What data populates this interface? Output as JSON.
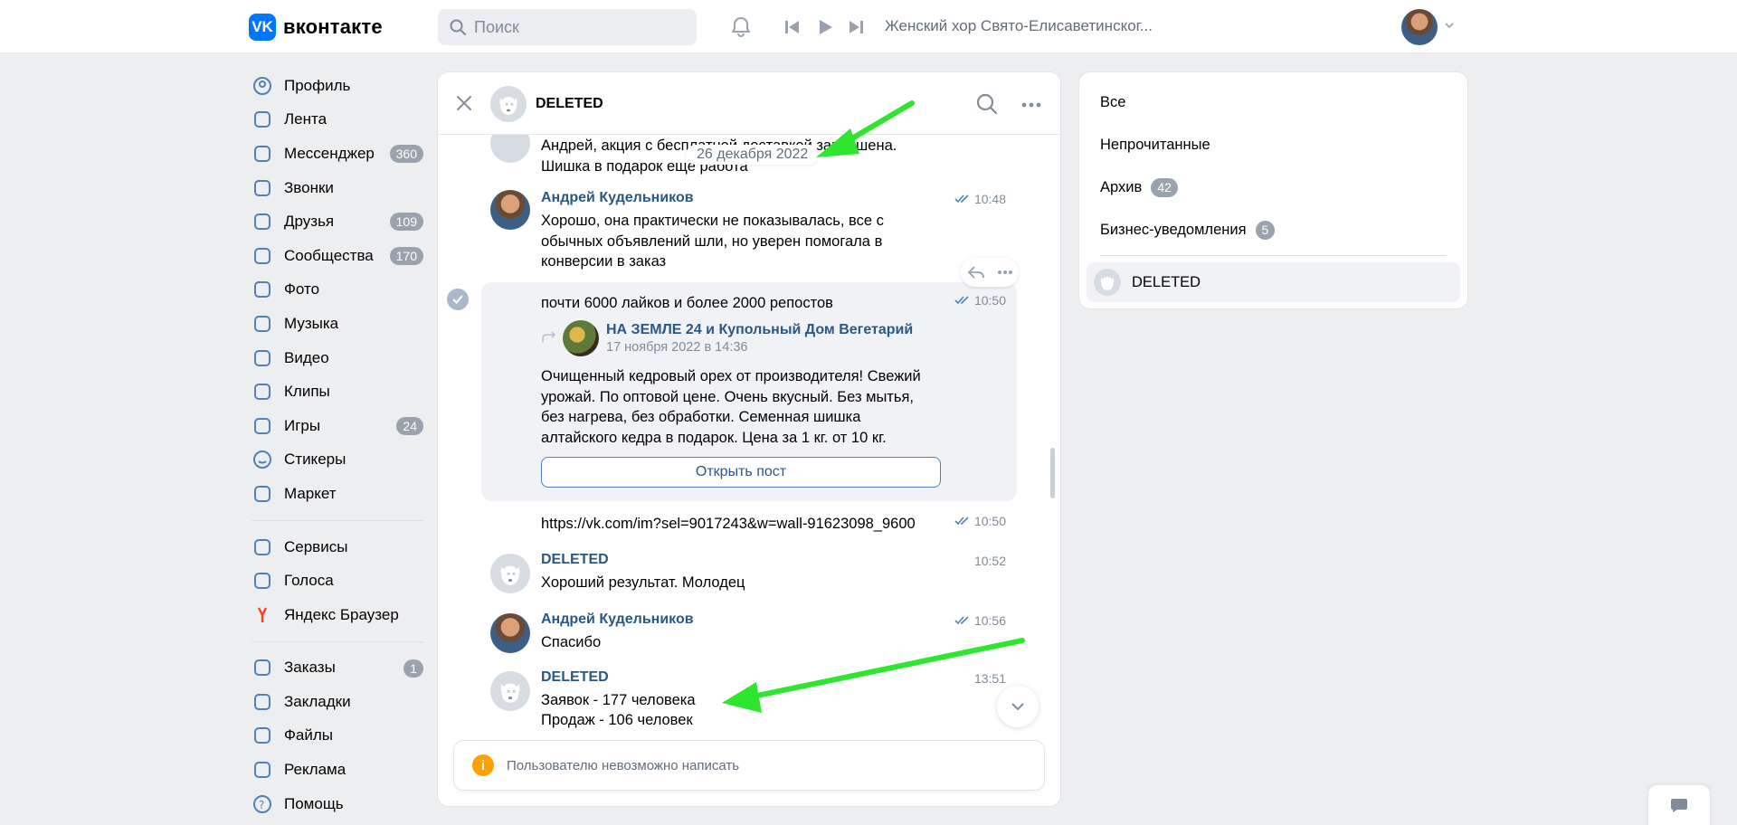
{
  "header": {
    "logo_text": "вконтакте",
    "logo_mark": "VK",
    "search_placeholder": "Поиск",
    "player_title": "Женский хор Свято-Елисаветинског..."
  },
  "nav": {
    "items": [
      {
        "label": "Профиль",
        "icon": "profile-icon"
      },
      {
        "label": "Лента",
        "icon": "feed-icon"
      },
      {
        "label": "Мессенджер",
        "icon": "messenger-icon",
        "badge": "360"
      },
      {
        "label": "Звонки",
        "icon": "phone-icon"
      },
      {
        "label": "Друзья",
        "icon": "friends-icon",
        "badge": "109"
      },
      {
        "label": "Сообщества",
        "icon": "communities-icon",
        "badge": "170"
      },
      {
        "label": "Фото",
        "icon": "photo-icon"
      },
      {
        "label": "Музыка",
        "icon": "music-icon"
      },
      {
        "label": "Видео",
        "icon": "video-icon"
      },
      {
        "label": "Клипы",
        "icon": "clips-icon"
      },
      {
        "label": "Игры",
        "icon": "games-icon",
        "badge": "24"
      },
      {
        "label": "Стикеры",
        "icon": "stickers-icon"
      },
      {
        "label": "Маркет",
        "icon": "market-icon"
      }
    ],
    "items2": [
      {
        "label": "Сервисы",
        "icon": "services-icon"
      },
      {
        "label": "Голоса",
        "icon": "votes-icon"
      },
      {
        "label": "Яндекс Браузер",
        "icon": "yandex-icon"
      }
    ],
    "items3": [
      {
        "label": "Заказы",
        "icon": "orders-icon",
        "badge": "1"
      },
      {
        "label": "Закладки",
        "icon": "bookmarks-icon"
      },
      {
        "label": "Файлы",
        "icon": "files-icon"
      },
      {
        "label": "Реклама",
        "icon": "ads-icon"
      },
      {
        "label": "Помощь",
        "icon": "help-icon"
      }
    ]
  },
  "chat": {
    "title": "DELETED",
    "date_pill": "26 декабря 2022",
    "messages": [
      {
        "text": "Андрей, акция с бесплатной доставкой завершена. Шишка в подарок ещё работа"
      },
      {
        "name": "Андрей Кудельников",
        "time": "10:48",
        "text": "Хорошо, она практически не показывалась, все с обычных объявлений шли, но уверен помогала в конверсии в заказ"
      },
      {
        "time": "10:50",
        "text": "почти 6000 лайков и более 2000 репостов"
      },
      {
        "time": "10:50",
        "text": "https://vk.com/im?sel=9017243&w=wall-91623098_9600"
      },
      {
        "name": "DELETED",
        "time": "10:52",
        "text": "Хороший результат. Молодец"
      },
      {
        "name": "Андрей Кудельников",
        "time": "10:56",
        "text": "Спасибо"
      },
      {
        "name": "DELETED",
        "time": "13:51",
        "text_line1": "Заявок - 177 человека",
        "text_line2": "Продаж - 106 человек"
      }
    ],
    "repost": {
      "name": "НА ЗЕМЛЕ 24 и Купольный Дом Вегетарий",
      "date": "17 ноября 2022 в 14:36",
      "text": "Очищенный кедровый орех от производителя! Свежий урожай. По оптовой цене. Очень вкусный. Без мытья, без нагрева, без обработки. Семенная шишка алтайского кедра в подарок. Цена за 1 кг. от 10 кг.",
      "button": "Открыть пост"
    },
    "notice": "Пользователю невозможно написать",
    "notice_icon": "i"
  },
  "filters": {
    "all": "Все",
    "unread": "Непрочитанные",
    "archive": "Архив",
    "archive_badge": "42",
    "business": "Бизнес-уведомления",
    "business_badge": "5",
    "active_chat": "DELETED"
  },
  "colors": {
    "accent": "#0077ff",
    "link": "#2a5885",
    "arrow": "#2ee62e",
    "badge": "#99a2ad",
    "warning": "#ffa000"
  }
}
